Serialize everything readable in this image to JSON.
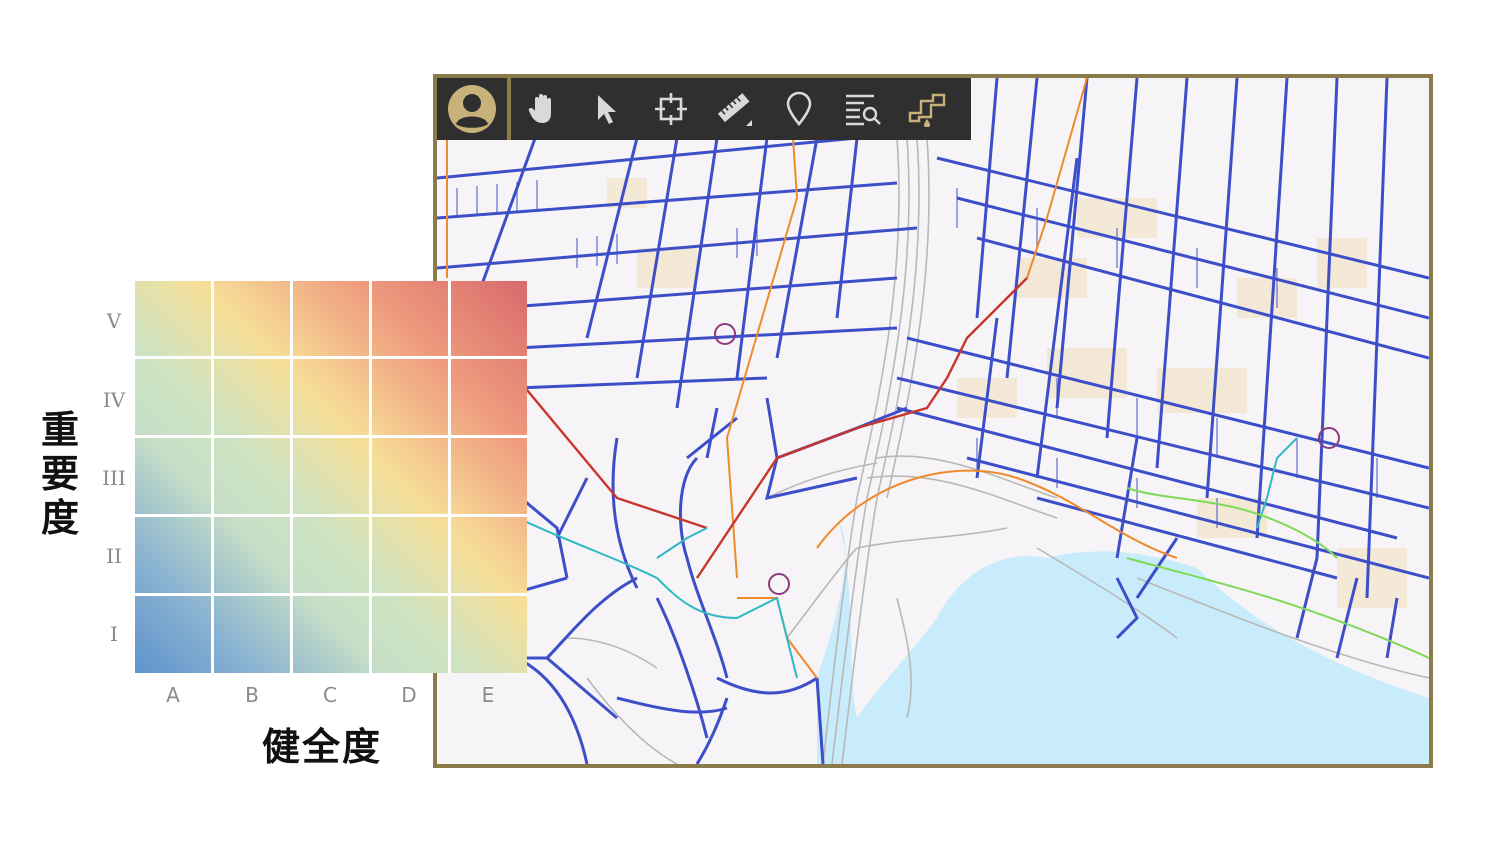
{
  "matrix": {
    "y_axis_title_chars": [
      "重",
      "要",
      "度"
    ],
    "x_axis_title": "健全度",
    "rows": [
      "V",
      "IV",
      "III",
      "II",
      "I"
    ],
    "columns": [
      "A",
      "B",
      "C",
      "D",
      "E"
    ],
    "gradient_colors": {
      "high": "#d86a6c",
      "medium_high": "#ef9c7e",
      "medium": "#f6df98",
      "low_medium": "#c6dfc6",
      "low": "#5f93cd"
    }
  },
  "toolbar": {
    "tools": [
      {
        "name": "user-icon"
      },
      {
        "name": "pan-hand-icon"
      },
      {
        "name": "select-arrow-icon"
      },
      {
        "name": "extent-crosshair-icon"
      },
      {
        "name": "measure-ruler-icon"
      },
      {
        "name": "location-pin-icon"
      },
      {
        "name": "search-list-icon"
      },
      {
        "name": "pipe-flow-icon"
      }
    ],
    "colors": {
      "background": "#2f2f2f",
      "icon": "#d9d9d9",
      "accent": "#c8b27a",
      "frame": "#8c7b4a"
    }
  },
  "map": {
    "colors": {
      "pipe_main": "#3d4fc8",
      "pipe_orange": "#ef8a2d",
      "pipe_red": "#c8352c",
      "pipe_teal": "#2fb8c6",
      "pipe_green": "#7ed957",
      "water": "#c8ecfb",
      "road": "#b8b8b8",
      "block": "#f3e6cd",
      "marker": "#8e3a7e"
    }
  }
}
